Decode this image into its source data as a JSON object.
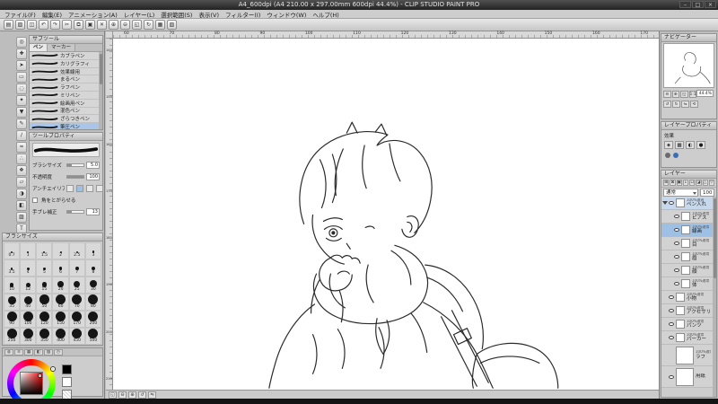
{
  "accent": "#2f6cb3",
  "window": {
    "title": "A4_600dpi (A4 210.00 x 297.00mm 600dpi 44.4%) - CLIP STUDIO PAINT PRO",
    "minimize": "–",
    "maximize": "□",
    "close": "×"
  },
  "menu": {
    "items": [
      "ファイル(F)",
      "編集(E)",
      "アニメーション(A)",
      "レイヤー(L)",
      "選択範囲(S)",
      "表示(V)",
      "フィルター(I)",
      "ウィンドウ(W)",
      "ヘルプ(H)"
    ]
  },
  "toolbar": {
    "icons": [
      {
        "n": "new-file-icon",
        "g": "▤"
      },
      {
        "n": "open-file-icon",
        "g": "▨"
      },
      {
        "n": "save-icon",
        "g": "◫"
      },
      {
        "n": "undo-icon",
        "g": "↶"
      },
      {
        "n": "redo-icon",
        "g": "↷"
      },
      {
        "n": "cut-icon",
        "g": "✂"
      },
      {
        "n": "copy-icon",
        "g": "⧉"
      },
      {
        "n": "paste-icon",
        "g": "▣"
      },
      {
        "n": "delete-icon",
        "g": "✕"
      },
      {
        "n": "zoom-in-icon",
        "g": "⊕"
      },
      {
        "n": "zoom-out-icon",
        "g": "⊖"
      },
      {
        "n": "fit-view-icon",
        "g": "◱"
      },
      {
        "n": "rotate-view-icon",
        "g": "↻"
      },
      {
        "n": "grid-icon",
        "g": "▦"
      },
      {
        "n": "snap-icon",
        "g": "▧"
      }
    ]
  },
  "tools": {
    "items": [
      {
        "n": "tool-zoom",
        "g": "◎"
      },
      {
        "n": "tool-move",
        "g": "✚"
      },
      {
        "n": "tool-operate",
        "g": "➤"
      },
      {
        "n": "tool-select",
        "g": "▭"
      },
      {
        "n": "tool-lasso",
        "g": "◌"
      },
      {
        "n": "tool-auto-select",
        "g": "✦"
      },
      {
        "n": "tool-eyedropper",
        "g": "▼"
      },
      {
        "n": "tool-pen",
        "g": "✎"
      },
      {
        "n": "tool-pencil",
        "g": "∕"
      },
      {
        "n": "tool-brush",
        "g": "≈"
      },
      {
        "n": "tool-airbrush",
        "g": "∴"
      },
      {
        "n": "tool-decoration",
        "g": "❖"
      },
      {
        "n": "tool-eraser",
        "g": "▱"
      },
      {
        "n": "tool-blend",
        "g": "◑"
      },
      {
        "n": "tool-fill",
        "g": "◧"
      },
      {
        "n": "tool-gradient",
        "g": "▨"
      },
      {
        "n": "tool-text",
        "g": "T"
      }
    ]
  },
  "subtool": {
    "title": "サブツール",
    "tabs": [
      {
        "label": "ペン",
        "active": true
      },
      {
        "label": "マーカー",
        "active": false
      }
    ],
    "items": [
      {
        "name": "カブラペン"
      },
      {
        "name": "カリグラフィ"
      },
      {
        "name": "効果線用"
      },
      {
        "name": "まるペン"
      },
      {
        "name": "ラフペン"
      },
      {
        "name": "ミリペン"
      },
      {
        "name": "絵画用ペン"
      },
      {
        "name": "混色ペン"
      },
      {
        "name": "ざらつきペン"
      },
      {
        "name": "筆圧ペン",
        "selected": true
      }
    ]
  },
  "toolprop": {
    "title": "ツールプロパティ",
    "rows": [
      {
        "label": "ブラシサイズ",
        "value": "5.0"
      },
      {
        "label": "不透明度",
        "value": "100"
      },
      {
        "label": "アンチエイリアス",
        "value": ""
      },
      {
        "label": "角をとがらせる",
        "value": ""
      },
      {
        "label": "手ブレ補正",
        "value": "13"
      }
    ]
  },
  "brush_sizes": {
    "title": "ブラシサイズ",
    "sizes": [
      0.7,
      1,
      1.5,
      2,
      2.5,
      3,
      3.5,
      4,
      5,
      6,
      7,
      8,
      10,
      12,
      15,
      20,
      25,
      30,
      35,
      40,
      50,
      60,
      70,
      80,
      90,
      100,
      120,
      150,
      170,
      200,
      250,
      300,
      350,
      400,
      450,
      500
    ]
  },
  "color": {
    "selected_hue": "#ff0000",
    "fg": "#000000",
    "bg": "#ffffff",
    "tabs": [
      {
        "n": "color-wheel-tab-icon",
        "g": "◍"
      },
      {
        "n": "color-slider-tab-icon",
        "g": "≡"
      },
      {
        "n": "color-set-tab-icon",
        "g": "▦"
      },
      {
        "n": "intermediate-color-tab-icon",
        "g": "◧"
      },
      {
        "n": "approximate-color-tab-icon",
        "g": "▨"
      },
      {
        "n": "color-history-tab-icon",
        "g": "◷"
      }
    ]
  },
  "rulers": {
    "top": [
      "60",
      "70",
      "80",
      "90",
      "100",
      "110",
      "120",
      "130",
      "140",
      "150",
      "160",
      "170"
    ],
    "left": [
      "140",
      "150",
      "160",
      "170",
      "180",
      "190",
      "200",
      "210"
    ]
  },
  "canvas_status": {
    "icons": [
      {
        "n": "fit-screen-icon",
        "g": "◱"
      },
      {
        "n": "zoom-out-icon",
        "g": "⊖"
      },
      {
        "n": "zoom-in-icon",
        "g": "⊕"
      },
      {
        "n": "rotate-left-icon",
        "g": "↺"
      },
      {
        "n": "flip-view-icon",
        "g": "⇋"
      }
    ]
  },
  "navigator": {
    "title": "ナビゲーター",
    "zoom": "44.4%",
    "zoom_icons": [
      {
        "n": "zoom-out-icon",
        "g": "⊖"
      },
      {
        "n": "zoom-in-icon",
        "g": "⊕"
      },
      {
        "n": "fit-to-window-icon",
        "g": "◱"
      },
      {
        "n": "actual-size-icon",
        "g": "1:1"
      }
    ],
    "rotate_icons": [
      {
        "n": "rotate-left-icon",
        "g": "↺"
      },
      {
        "n": "rotate-right-icon",
        "g": "↻"
      },
      {
        "n": "flip-horizontal-icon",
        "g": "⇋"
      },
      {
        "n": "reset-view-icon",
        "g": "⟲"
      }
    ]
  },
  "layer_property": {
    "title": "レイヤープロパティ",
    "effect_label": "効果",
    "icons": [
      {
        "n": "border-effect-icon",
        "g": "◈"
      },
      {
        "n": "tone-effect-icon",
        "g": "▩"
      },
      {
        "n": "layer-color-icon",
        "g": "◐"
      },
      {
        "n": "expression-color-icon",
        "g": "●"
      }
    ]
  },
  "layers": {
    "title": "レイヤー",
    "blend_mode": "通常",
    "opacity": "100",
    "palette_icons": [
      {
        "n": "new-raster-layer-icon",
        "g": "⊞"
      },
      {
        "n": "new-vector-layer-icon",
        "g": "⊠"
      },
      {
        "n": "new-folder-icon",
        "g": "▣"
      },
      {
        "n": "transfer-layer-icon",
        "g": "↧"
      },
      {
        "n": "combine-layer-icon",
        "g": "⊔"
      },
      {
        "n": "mask-icon",
        "g": "◪"
      },
      {
        "n": "ruler-layer-icon",
        "g": "△"
      },
      {
        "n": "delete-layer-icon",
        "g": "▽"
      }
    ],
    "items": [
      {
        "name": "ペン入れ",
        "info": "100%通過",
        "folder": true
      },
      {
        "name": "ピアス",
        "info": "100%通常",
        "indent": true
      },
      {
        "name": "線画",
        "info": "100%通常",
        "selected": true,
        "indent": true
      },
      {
        "name": "目",
        "info": "100%通常",
        "indent": true
      },
      {
        "name": "眉",
        "info": "100%通常",
        "indent": true
      },
      {
        "name": "顔",
        "info": "100%通常",
        "indent": true
      },
      {
        "name": "体",
        "info": "100%通常",
        "indent": true
      },
      {
        "name": "小物",
        "info": "100%通常"
      },
      {
        "name": "アクセサリー",
        "info": "100%通常"
      },
      {
        "name": "パンツ",
        "info": "100%通常"
      },
      {
        "name": "パーカー",
        "info": "100%通常"
      },
      {
        "name": "ラフ",
        "info": "100%通常",
        "big": true,
        "invisible": true
      },
      {
        "name": "用紙",
        "info": "",
        "big": true
      }
    ]
  }
}
